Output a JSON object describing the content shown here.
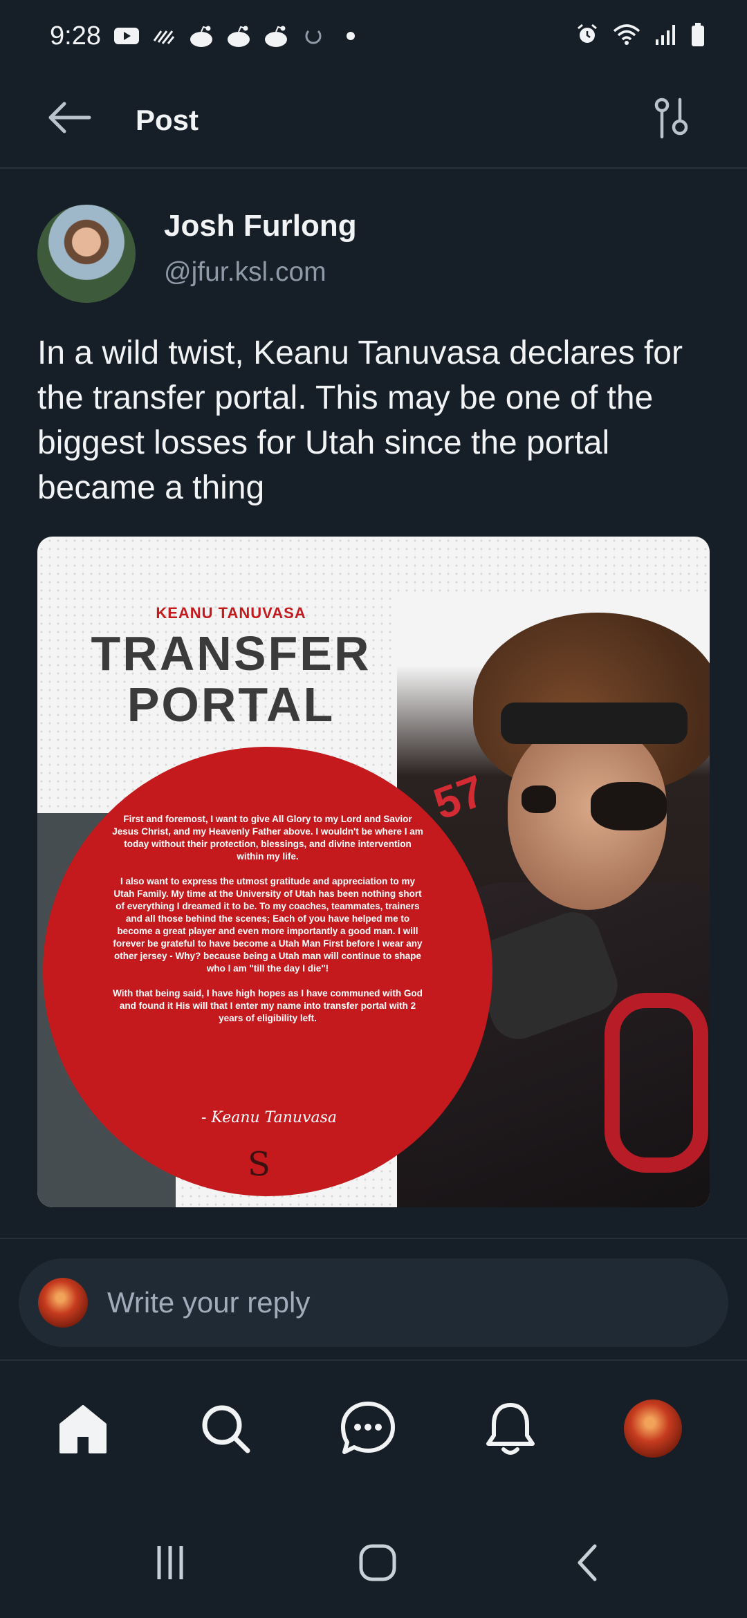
{
  "status_bar": {
    "time": "9:28",
    "left_icons": [
      "youtube-icon",
      "signal-app-icon",
      "reddit-icon",
      "reddit-icon",
      "reddit-icon",
      "sync-icon",
      "dot-icon"
    ],
    "right_icons": [
      "alarm-icon",
      "wifi-icon",
      "cell-signal-icon",
      "battery-icon"
    ]
  },
  "header": {
    "title": "Post"
  },
  "post": {
    "author_name": "Josh Furlong",
    "author_handle": "@jfur.ksl.com",
    "text": "In a wild twist, Keanu Tanuvasa declares for the transfer portal. This may be one of the biggest losses for Utah since the portal became a thing",
    "image": {
      "name_line": "KEANU TANUVASA",
      "title_line1": "TRANSFER",
      "title_line2": "PORTAL",
      "letter_paragraphs": [
        "First and foremost, I want to give All Glory to my Lord and Savior Jesus Christ, and my Heavenly Father above. I wouldn't be where I am today without their protection, blessings, and divine intervention within my life.",
        "I also want to express the utmost gratitude and appreciation to my Utah Family. My time at the University of Utah has been nothing short of everything I dreamed it to be. To my coaches, teammates, trainers and all those behind the scenes; Each of you have helped me to become a great player and even more importantly a good man. I will forever be grateful to have become a Utah Man First before I wear any other jersey - Why? because being a Utah man will continue to shape who I am \"till the day I die\"!",
        "With that being said, I have high hopes as I have communed with God and found it His will that I enter my name into transfer portal with 2 years of eligibility left."
      ],
      "signature": "- Keanu Tanuvasa",
      "logo_mark": "S",
      "jersey_number": "57"
    }
  },
  "reply": {
    "placeholder": "Write your reply"
  },
  "bottom_nav": {
    "items": [
      "home-icon",
      "search-icon",
      "chat-icon",
      "notifications-icon",
      "profile-avatar"
    ]
  },
  "colors": {
    "background": "#161e27",
    "text_primary": "#f1f3f5",
    "text_secondary": "#8e9aa8",
    "reply_bg": "#1f2a35",
    "utah_red": "#c41a1e"
  }
}
